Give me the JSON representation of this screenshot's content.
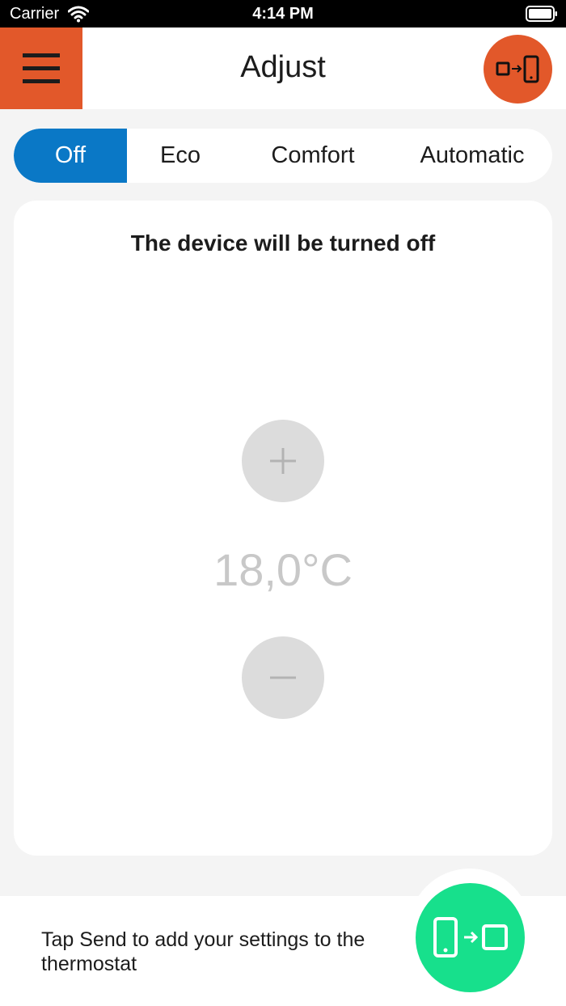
{
  "status_bar": {
    "carrier": "Carrier",
    "time": "4:14 PM"
  },
  "header": {
    "title": "Adjust",
    "menu_icon": "hamburger-menu-icon",
    "receive_icon": "thermostat-to-phone-icon"
  },
  "mode_tabs": {
    "selected": "Off",
    "items": [
      {
        "label": "Off"
      },
      {
        "label": "Eco"
      },
      {
        "label": "Comfort"
      },
      {
        "label": "Automatic"
      }
    ]
  },
  "card": {
    "message": "The device will be turned off",
    "temperature": "18,0°C",
    "plus_icon": "plus-icon",
    "minus_icon": "minus-icon"
  },
  "bottom": {
    "hint": "Tap Send to add your settings to the thermostat",
    "send_icon": "phone-to-thermostat-icon"
  },
  "colors": {
    "accent_orange": "#e2582a",
    "selected_blue": "#0a78c6",
    "send_green": "#17e08c",
    "disabled_gray": "#dcdcdc"
  }
}
